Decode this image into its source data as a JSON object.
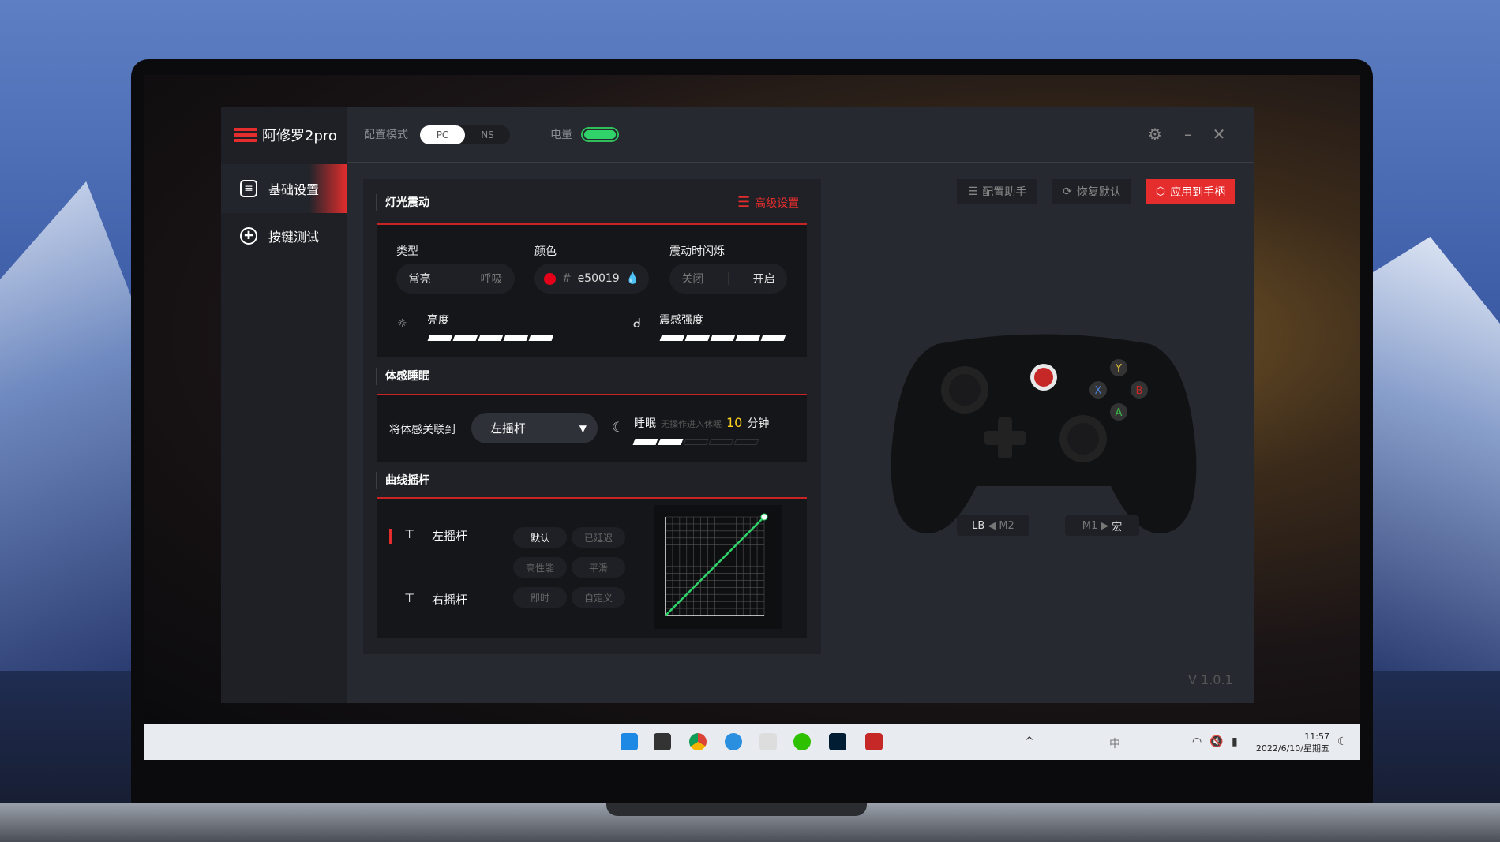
{
  "app": {
    "title": "阿修罗2pro",
    "logo_icon": "asura-logo-icon"
  },
  "header": {
    "mode_label": "配置模式",
    "modes": [
      "PC",
      "NS"
    ],
    "selected_mode": "PC",
    "battery_label": "电量",
    "battery_level": 100,
    "battery_color": "#2fd36a",
    "settings_icon": "gear-icon",
    "minimize_icon": "minimize-icon",
    "close_icon": "close-icon"
  },
  "sidebar": {
    "items": [
      {
        "label": "基础设置",
        "icon": "controller-settings-icon",
        "active": true
      },
      {
        "label": "按键测试",
        "icon": "dpad-icon",
        "active": false
      }
    ]
  },
  "light": {
    "title": "灯光震动",
    "advanced": "高级设置",
    "type_label": "类型",
    "types": [
      "常亮",
      "呼吸"
    ],
    "selected_type": "常亮",
    "color_label": "颜色",
    "color_hash": "#",
    "color_value": "e50019",
    "color_hex": "#e50019",
    "flash_label": "震动时闪烁",
    "flash_options": [
      "关闭",
      "开启"
    ],
    "flash_selected": "开启",
    "brightness_label": "亮度",
    "brightness_level": 5,
    "vibration_label": "震感强度",
    "vibration_level": 5,
    "max_level": 5
  },
  "sleep": {
    "title": "体感睡眠",
    "link_label": "将体感关联到",
    "link_value": "左摇杆",
    "sleep_label": "睡眠",
    "sleep_hint": "无操作进入休眠",
    "sleep_minutes": "10",
    "sleep_unit": "分钟",
    "sleep_level": 2
  },
  "curve": {
    "title": "曲线摇杆",
    "sticks": [
      "左摇杆",
      "右摇杆"
    ],
    "selected_stick": "左摇杆",
    "presets": [
      "默认",
      "已延迟",
      "高性能",
      "平滑",
      "即时",
      "自定义"
    ],
    "selected_preset": "默认",
    "line_color": "#2fd36a"
  },
  "toolbar": {
    "assistant": "配置助手",
    "restore": "恢复默认",
    "apply": "应用到手柄",
    "accent": "#e52d2d"
  },
  "controller": {
    "left_tag": {
      "a": "LB",
      "b": "M2"
    },
    "right_tag": {
      "a": "M1",
      "b": "宏"
    }
  },
  "version": "V 1.0.1",
  "taskbar": {
    "time": "11:57",
    "date": "2022/6/10/星期五",
    "ime": "中"
  }
}
